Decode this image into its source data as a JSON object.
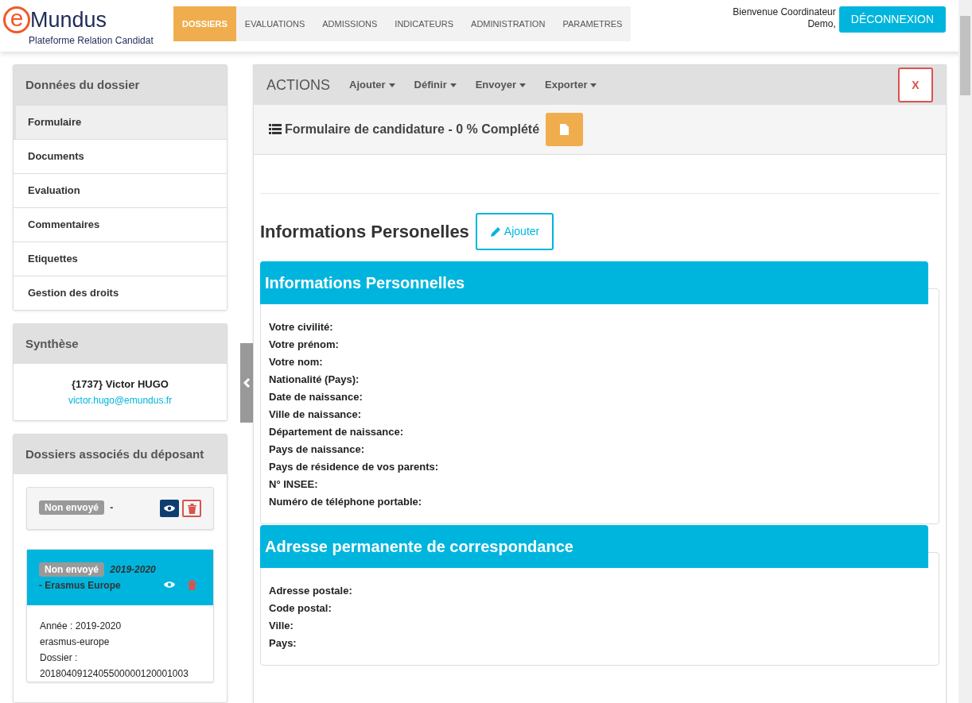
{
  "logo": {
    "mark": "e",
    "name": "Mundus",
    "tagline": "Plateforme Relation Candidat"
  },
  "nav": [
    {
      "label": "DOSSIERS",
      "selected": true
    },
    {
      "label": "EVALUATIONS",
      "selected": false
    },
    {
      "label": "ADMISSIONS",
      "selected": false
    },
    {
      "label": "INDICATEURS",
      "selected": false
    },
    {
      "label": "ADMINISTRATION",
      "selected": false
    },
    {
      "label": "PARAMETRES",
      "selected": false
    }
  ],
  "user": {
    "greeting": "Bienvenue Coordinateur Demo,",
    "logout": "DÉCONNEXION"
  },
  "sidebar": {
    "title": "Données du dossier",
    "items": [
      {
        "label": "Formulaire",
        "selected": true
      },
      {
        "label": "Documents",
        "selected": false
      },
      {
        "label": "Evaluation",
        "selected": false
      },
      {
        "label": "Commentaires",
        "selected": false
      },
      {
        "label": "Etiquettes",
        "selected": false
      },
      {
        "label": "Gestion des droits",
        "selected": false
      }
    ]
  },
  "synthese": {
    "title": "Synthèse",
    "applicant": "{1737} Victor HUGO",
    "email": "victor.hugo@emundus.fr"
  },
  "associated": {
    "title": "Dossiers associés du déposant",
    "files": [
      {
        "status": "Non envoyé",
        "text": "-",
        "selected": false
      },
      {
        "status": "Non envoyé",
        "text": "*2019-2020* - Erasmus Europe",
        "selected": true,
        "details": [
          "Année : 2019-2020",
          "erasmus-europe",
          "Dossier :",
          "2018040912405500000120001003"
        ]
      }
    ]
  },
  "actions": {
    "title": "ACTIONS",
    "menus": [
      "Ajouter",
      "Définir",
      "Envoyer",
      "Exporter"
    ],
    "close": "X"
  },
  "form": {
    "title": "Formulaire de candidature - 0 % Complété",
    "heading": "Informations Personelles",
    "add_button": "Ajouter",
    "sections": [
      {
        "title": "Informations Personnelles",
        "fields": [
          "Votre civilité:",
          "Votre prénom:",
          "Votre nom:",
          "Nationalité (Pays):",
          "Date de naissance:",
          "Ville de naissance:",
          "Département de naissance:",
          "Pays de naissance:",
          "Pays de résidence de vos parents:",
          "N° INSEE:",
          "Numéro de téléphone portable:"
        ]
      },
      {
        "title": "Adresse permanente de correspondance",
        "fields": [
          "Adresse postale:",
          "Code postal:",
          "Ville:",
          "Pays:"
        ]
      }
    ]
  }
}
